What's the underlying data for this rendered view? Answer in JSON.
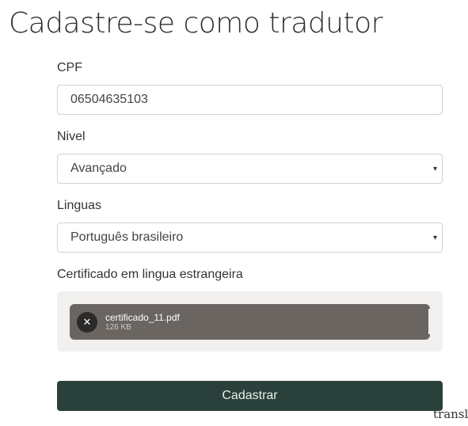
{
  "page": {
    "title": "Cadastre-se como tradutor"
  },
  "form": {
    "cpf": {
      "label": "CPF",
      "value": "06504635103"
    },
    "nivel": {
      "label": "Nivel",
      "selected": "Avançado",
      "caret": "▾"
    },
    "linguas": {
      "label": "Linguas",
      "selected": "Português brasileiro",
      "caret": "▾"
    },
    "certificado": {
      "label": "Certificado em lingua estrangeira",
      "file": {
        "name": "certificado_11.pdf",
        "size": "126 KB",
        "remove_glyph": "✕"
      }
    },
    "submit_label": "Cadastrar"
  },
  "footer": {
    "text": "transl"
  },
  "colors": {
    "submit": "#29403b",
    "file_item": "#6a6561",
    "dropzone": "#f1f0ef"
  },
  "icons": {
    "remove": "close-icon",
    "dropdown": "chevron-down-icon"
  }
}
